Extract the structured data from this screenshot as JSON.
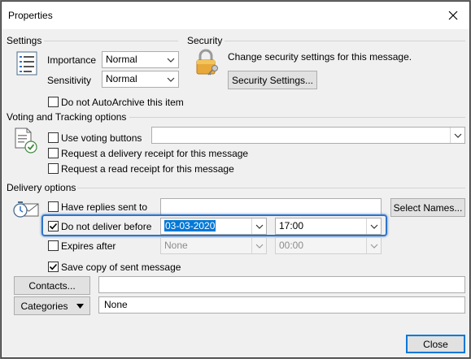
{
  "window": {
    "title": "Properties"
  },
  "settings": {
    "heading": "Settings",
    "importance_label": "Importance",
    "importance_value": "Normal",
    "sensitivity_label": "Sensitivity",
    "sensitivity_value": "Normal",
    "no_autoarchive_label": "Do not AutoArchive this item",
    "no_autoarchive_checked": false
  },
  "security": {
    "heading": "Security",
    "description": "Change security settings for this message.",
    "button_label": "Security Settings..."
  },
  "voting": {
    "heading": "Voting and Tracking options",
    "use_voting_label": "Use voting buttons",
    "use_voting_value": "",
    "delivery_receipt_label": "Request a delivery receipt for this message",
    "read_receipt_label": "Request a read receipt for this message"
  },
  "delivery": {
    "heading": "Delivery options",
    "replies_label": "Have replies sent to",
    "replies_value": "",
    "select_names_label": "Select Names...",
    "not_before_label": "Do not deliver before",
    "not_before_checked": true,
    "not_before_date": "03-03-2020",
    "not_before_time": "17:00",
    "expires_label": "Expires after",
    "expires_checked": false,
    "expires_date": "None",
    "expires_time": "00:00",
    "save_copy_label": "Save copy of sent message",
    "save_copy_checked": true
  },
  "contacts": {
    "button_label": "Contacts...",
    "value": ""
  },
  "categories": {
    "button_label": "Categories",
    "value": "None"
  },
  "footer": {
    "close_label": "Close"
  },
  "colors": {
    "accent": "#0078d7",
    "highlight_border": "#2e74c9",
    "dialog_bg": "#f0f0f0"
  }
}
